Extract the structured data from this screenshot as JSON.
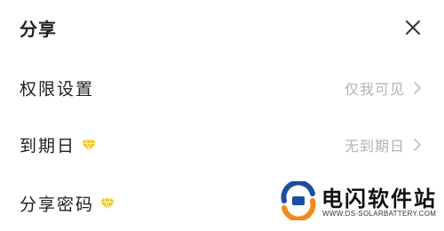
{
  "header": {
    "title": "分享",
    "close_icon": "close-icon"
  },
  "rows": [
    {
      "label": "权限设置",
      "value": "仅我可见",
      "vip": false
    },
    {
      "label": "到期日",
      "value": "无到期日",
      "vip": true
    },
    {
      "label": "分享密码",
      "value": "",
      "vip": true
    }
  ],
  "watermark": {
    "name": "电闪软件站",
    "url": "WWW.DS-SOLARBATTERY.COM"
  },
  "colors": {
    "label": "#1f1f1f",
    "value": "#b3b3b3",
    "vip_gold": "#f5c518",
    "logo_blue": "#1a4fa0",
    "logo_orange": "#f08a1c"
  }
}
